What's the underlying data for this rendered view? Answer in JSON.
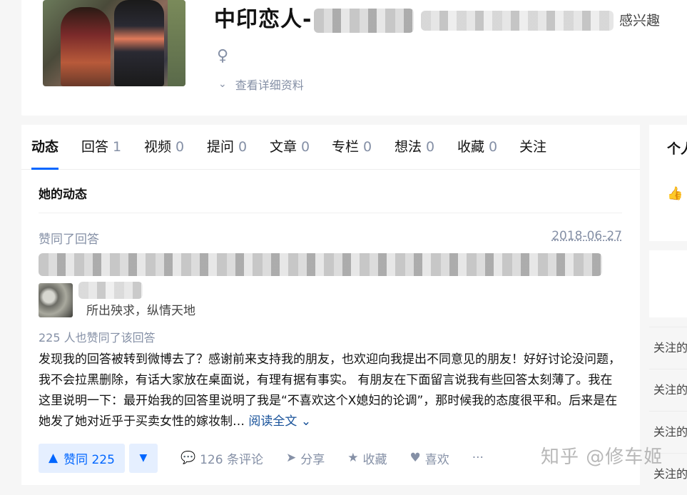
{
  "header": {
    "name": "中印恋人-",
    "headline_visible": "感兴趣",
    "gender_icon": "female-icon",
    "detail_link": "查看详细资料"
  },
  "tabs": [
    {
      "label": "动态",
      "count": ""
    },
    {
      "label": "回答",
      "count": "1"
    },
    {
      "label": "视频",
      "count": "0"
    },
    {
      "label": "提问",
      "count": "0"
    },
    {
      "label": "文章",
      "count": "0"
    },
    {
      "label": "专栏",
      "count": "0"
    },
    {
      "label": "想法",
      "count": "0"
    },
    {
      "label": "收藏",
      "count": "0"
    },
    {
      "label": "关注",
      "count": ""
    }
  ],
  "feed": {
    "section_title": "她的动态",
    "item": {
      "action": "赞同了回答",
      "date": "2018-06-27",
      "author_bio": "所出殃求，纵情天地",
      "voters": "225 人也赞同了该回答",
      "excerpt": "发现我的回答被转到微博去了？感谢前来支持我的朋友，也欢迎向我提出不同意见的朋友！好好讨论没问题，我不会拉黑删除，有话大家放在桌面说，有理有据有事实。 有朋友在下面留言说我有些回答太刻薄了。我在这里说明一下：最开始我的回答里说明了我是“不喜欢这个X媳妇的论调”，那时候我的态度很平和。后来是在她发了她对近乎于买卖女性的嫁妆制…",
      "read_more": "阅读全文",
      "vote_up": "赞同 225",
      "comments": "126 条评论",
      "share": "分享",
      "favorite": "收藏",
      "like": "喜欢",
      "more": "···"
    }
  },
  "sidebar": {
    "card_title": "个人",
    "follow_items": [
      "关注的",
      "关注的",
      "关注的",
      "关注的"
    ]
  },
  "watermark": "知乎 @修车姬",
  "colors": {
    "accent": "#0066ff",
    "muted": "#8590a6",
    "link": "#175199"
  }
}
